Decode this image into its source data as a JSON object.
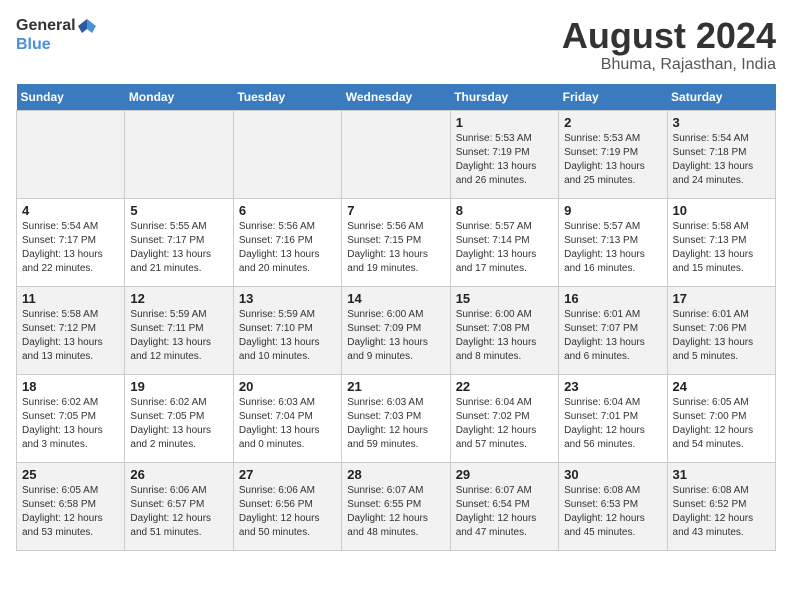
{
  "header": {
    "logo_general": "General",
    "logo_blue": "Blue",
    "title": "August 2024",
    "subtitle": "Bhuma, Rajasthan, India"
  },
  "days_of_week": [
    "Sunday",
    "Monday",
    "Tuesday",
    "Wednesday",
    "Thursday",
    "Friday",
    "Saturday"
  ],
  "weeks": [
    [
      {
        "day": "",
        "content": ""
      },
      {
        "day": "",
        "content": ""
      },
      {
        "day": "",
        "content": ""
      },
      {
        "day": "",
        "content": ""
      },
      {
        "day": "1",
        "content": "Sunrise: 5:53 AM\nSunset: 7:19 PM\nDaylight: 13 hours\nand 26 minutes."
      },
      {
        "day": "2",
        "content": "Sunrise: 5:53 AM\nSunset: 7:19 PM\nDaylight: 13 hours\nand 25 minutes."
      },
      {
        "day": "3",
        "content": "Sunrise: 5:54 AM\nSunset: 7:18 PM\nDaylight: 13 hours\nand 24 minutes."
      }
    ],
    [
      {
        "day": "4",
        "content": "Sunrise: 5:54 AM\nSunset: 7:17 PM\nDaylight: 13 hours\nand 22 minutes."
      },
      {
        "day": "5",
        "content": "Sunrise: 5:55 AM\nSunset: 7:17 PM\nDaylight: 13 hours\nand 21 minutes."
      },
      {
        "day": "6",
        "content": "Sunrise: 5:56 AM\nSunset: 7:16 PM\nDaylight: 13 hours\nand 20 minutes."
      },
      {
        "day": "7",
        "content": "Sunrise: 5:56 AM\nSunset: 7:15 PM\nDaylight: 13 hours\nand 19 minutes."
      },
      {
        "day": "8",
        "content": "Sunrise: 5:57 AM\nSunset: 7:14 PM\nDaylight: 13 hours\nand 17 minutes."
      },
      {
        "day": "9",
        "content": "Sunrise: 5:57 AM\nSunset: 7:13 PM\nDaylight: 13 hours\nand 16 minutes."
      },
      {
        "day": "10",
        "content": "Sunrise: 5:58 AM\nSunset: 7:13 PM\nDaylight: 13 hours\nand 15 minutes."
      }
    ],
    [
      {
        "day": "11",
        "content": "Sunrise: 5:58 AM\nSunset: 7:12 PM\nDaylight: 13 hours\nand 13 minutes."
      },
      {
        "day": "12",
        "content": "Sunrise: 5:59 AM\nSunset: 7:11 PM\nDaylight: 13 hours\nand 12 minutes."
      },
      {
        "day": "13",
        "content": "Sunrise: 5:59 AM\nSunset: 7:10 PM\nDaylight: 13 hours\nand 10 minutes."
      },
      {
        "day": "14",
        "content": "Sunrise: 6:00 AM\nSunset: 7:09 PM\nDaylight: 13 hours\nand 9 minutes."
      },
      {
        "day": "15",
        "content": "Sunrise: 6:00 AM\nSunset: 7:08 PM\nDaylight: 13 hours\nand 8 minutes."
      },
      {
        "day": "16",
        "content": "Sunrise: 6:01 AM\nSunset: 7:07 PM\nDaylight: 13 hours\nand 6 minutes."
      },
      {
        "day": "17",
        "content": "Sunrise: 6:01 AM\nSunset: 7:06 PM\nDaylight: 13 hours\nand 5 minutes."
      }
    ],
    [
      {
        "day": "18",
        "content": "Sunrise: 6:02 AM\nSunset: 7:05 PM\nDaylight: 13 hours\nand 3 minutes."
      },
      {
        "day": "19",
        "content": "Sunrise: 6:02 AM\nSunset: 7:05 PM\nDaylight: 13 hours\nand 2 minutes."
      },
      {
        "day": "20",
        "content": "Sunrise: 6:03 AM\nSunset: 7:04 PM\nDaylight: 13 hours\nand 0 minutes."
      },
      {
        "day": "21",
        "content": "Sunrise: 6:03 AM\nSunset: 7:03 PM\nDaylight: 12 hours\nand 59 minutes."
      },
      {
        "day": "22",
        "content": "Sunrise: 6:04 AM\nSunset: 7:02 PM\nDaylight: 12 hours\nand 57 minutes."
      },
      {
        "day": "23",
        "content": "Sunrise: 6:04 AM\nSunset: 7:01 PM\nDaylight: 12 hours\nand 56 minutes."
      },
      {
        "day": "24",
        "content": "Sunrise: 6:05 AM\nSunset: 7:00 PM\nDaylight: 12 hours\nand 54 minutes."
      }
    ],
    [
      {
        "day": "25",
        "content": "Sunrise: 6:05 AM\nSunset: 6:58 PM\nDaylight: 12 hours\nand 53 minutes."
      },
      {
        "day": "26",
        "content": "Sunrise: 6:06 AM\nSunset: 6:57 PM\nDaylight: 12 hours\nand 51 minutes."
      },
      {
        "day": "27",
        "content": "Sunrise: 6:06 AM\nSunset: 6:56 PM\nDaylight: 12 hours\nand 50 minutes."
      },
      {
        "day": "28",
        "content": "Sunrise: 6:07 AM\nSunset: 6:55 PM\nDaylight: 12 hours\nand 48 minutes."
      },
      {
        "day": "29",
        "content": "Sunrise: 6:07 AM\nSunset: 6:54 PM\nDaylight: 12 hours\nand 47 minutes."
      },
      {
        "day": "30",
        "content": "Sunrise: 6:08 AM\nSunset: 6:53 PM\nDaylight: 12 hours\nand 45 minutes."
      },
      {
        "day": "31",
        "content": "Sunrise: 6:08 AM\nSunset: 6:52 PM\nDaylight: 12 hours\nand 43 minutes."
      }
    ]
  ]
}
